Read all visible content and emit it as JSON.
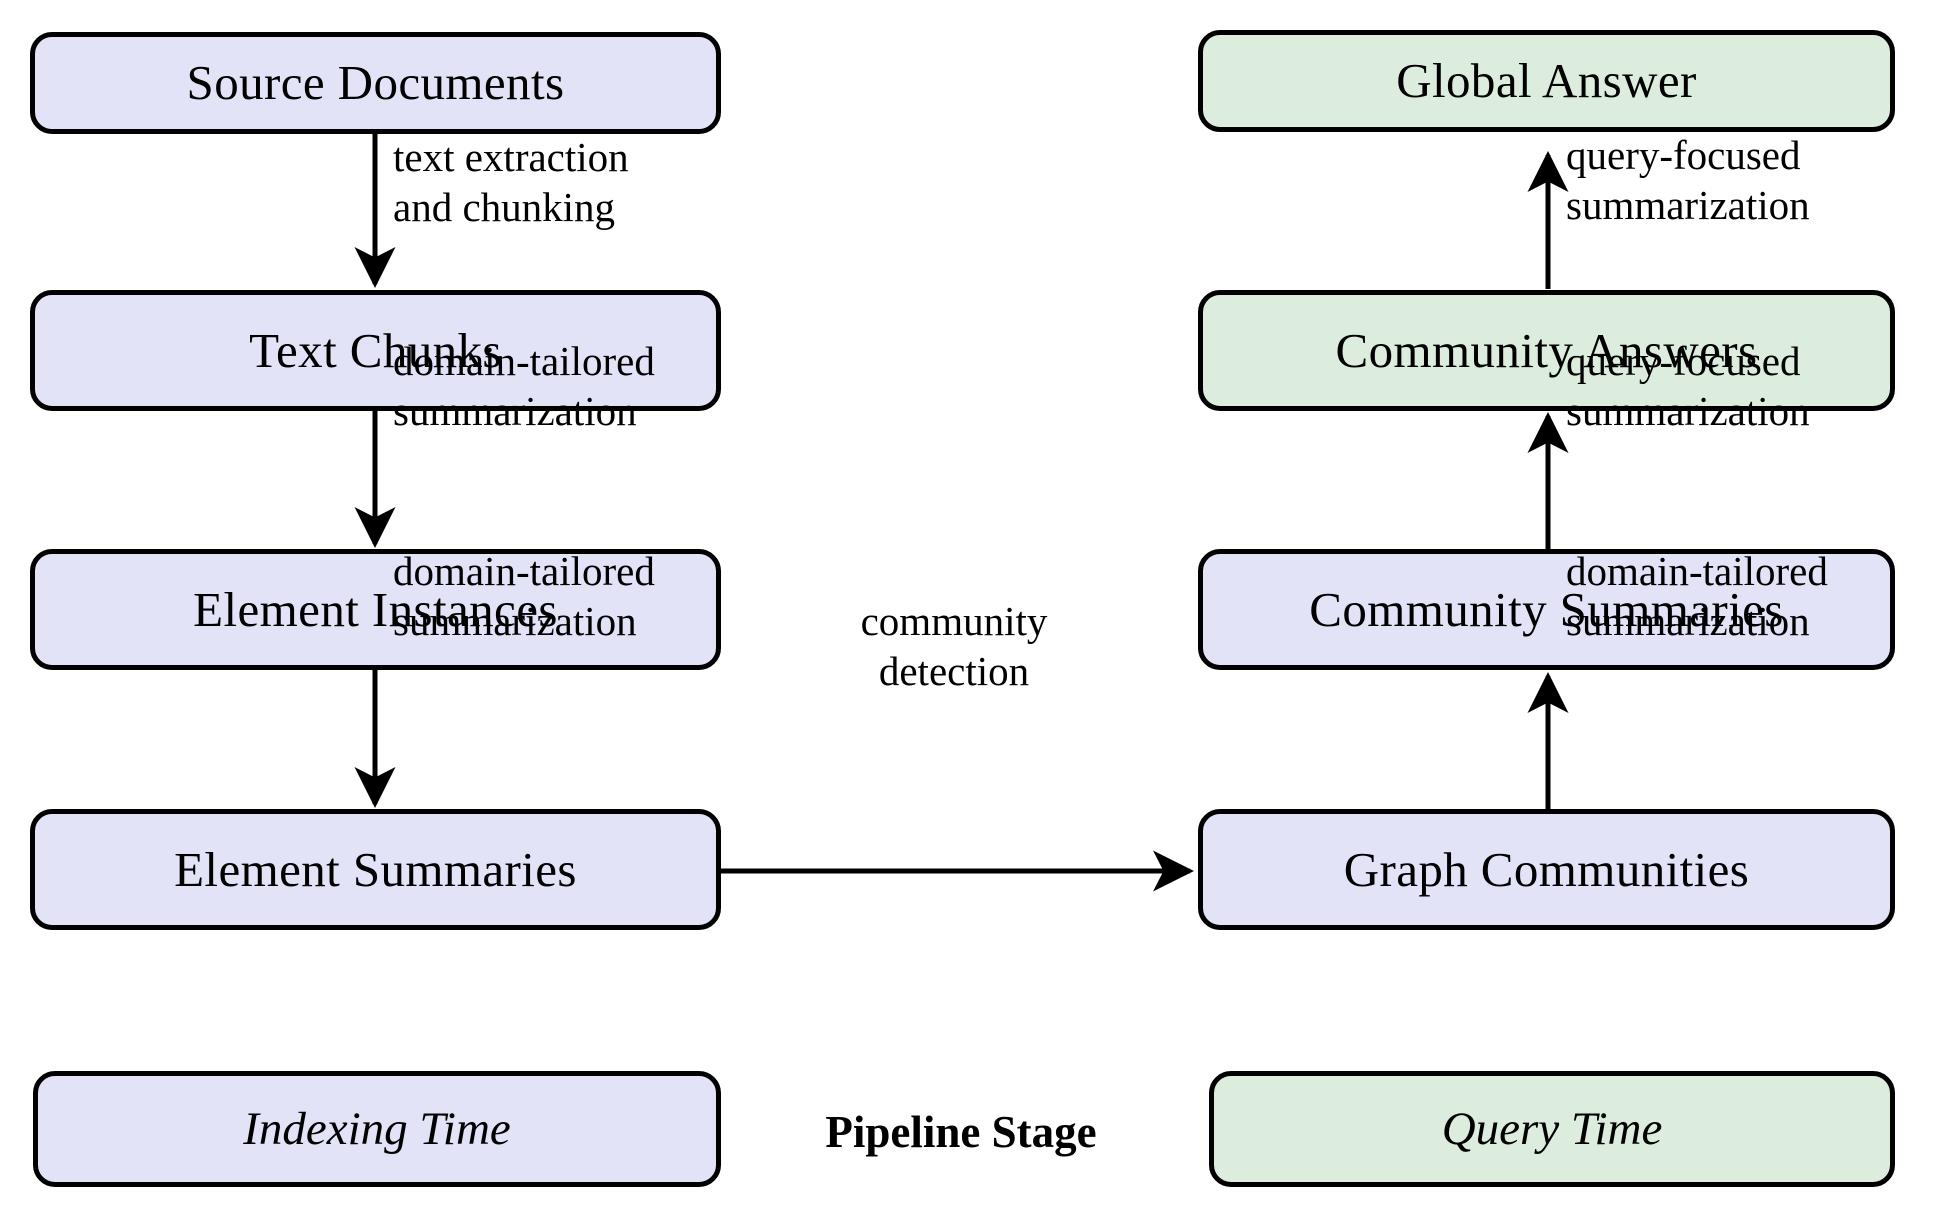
{
  "diagram": {
    "indexing_nodes": [
      {
        "id": "source-documents",
        "label": "Source Documents",
        "stage": "indexing"
      },
      {
        "id": "text-chunks",
        "label": "Text Chunks",
        "stage": "indexing"
      },
      {
        "id": "element-instances",
        "label": "Element Instances",
        "stage": "indexing"
      },
      {
        "id": "element-summaries",
        "label": "Element Summaries",
        "stage": "indexing"
      }
    ],
    "query_nodes": [
      {
        "id": "global-answer",
        "label": "Global Answer",
        "stage": "query"
      },
      {
        "id": "community-answers",
        "label": "Community Answers",
        "stage": "query"
      },
      {
        "id": "community-summaries",
        "label": "Community Summaries",
        "stage": "indexing"
      },
      {
        "id": "graph-communities",
        "label": "Graph Communities",
        "stage": "indexing"
      }
    ],
    "edges": [
      {
        "id": "e1",
        "from": "source-documents",
        "to": "text-chunks",
        "line1": "text extraction",
        "line2": "and chunking"
      },
      {
        "id": "e2",
        "from": "text-chunks",
        "to": "element-instances",
        "line1": "domain-tailored",
        "line2": "summarization"
      },
      {
        "id": "e3",
        "from": "element-instances",
        "to": "element-summaries",
        "line1": "domain-tailored",
        "line2": "summarization"
      },
      {
        "id": "e4",
        "from": "element-summaries",
        "to": "graph-communities",
        "line1": "community",
        "line2": "detection"
      },
      {
        "id": "e5",
        "from": "graph-communities",
        "to": "community-summaries",
        "line1": "domain-tailored",
        "line2": "summarization"
      },
      {
        "id": "e6",
        "from": "community-summaries",
        "to": "community-answers",
        "line1": "query-focused",
        "line2": "summarization"
      },
      {
        "id": "e7",
        "from": "community-answers",
        "to": "global-answer",
        "line1": "query-focused",
        "line2": "summarization"
      }
    ],
    "legend": {
      "indexing_label": "Indexing Time",
      "title": "Pipeline Stage",
      "query_label": "Query Time"
    },
    "colors": {
      "indexing_fill": "#e3e3f8",
      "query_fill": "#dcedde",
      "stroke": "#000000",
      "background": "#ffffff"
    }
  }
}
